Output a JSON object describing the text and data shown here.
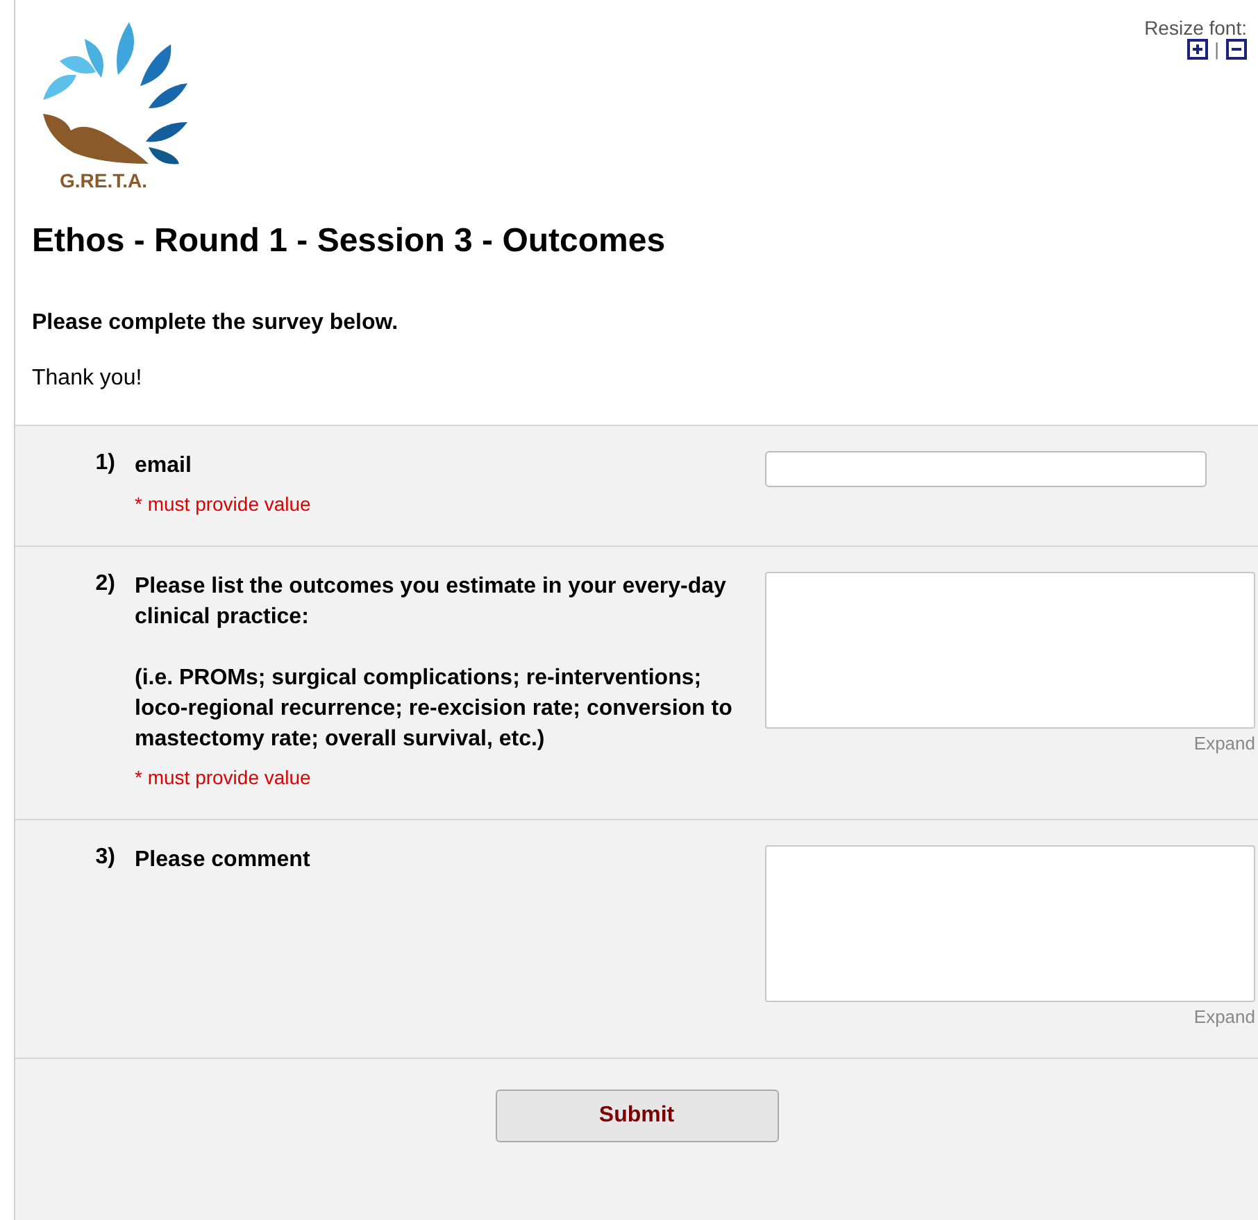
{
  "logo": {
    "text": "G.RE.T.A."
  },
  "resize_font": {
    "label": "Resize font:",
    "separator": "|"
  },
  "title": "Ethos - Round 1 - Session 3 - Outcomes",
  "instructions": "Please complete the survey below.",
  "thanks": "Thank you!",
  "questions": [
    {
      "number": "1)",
      "kind": "text",
      "label": "email",
      "required_note": "* must provide value"
    },
    {
      "number": "2)",
      "kind": "textarea",
      "label": "Please list the outcomes you estimate in your every-day clinical practice:",
      "note": "(i.e. PROMs; surgical complications; re-interventions; loco-regional recurrence; re-excision rate; conversion to mastectomy rate; overall survival, etc.)",
      "required_note": "* must provide value",
      "expand": "Expand"
    },
    {
      "number": "3)",
      "kind": "textarea",
      "label": "Please comment",
      "expand": "Expand"
    }
  ],
  "submit": "Submit"
}
